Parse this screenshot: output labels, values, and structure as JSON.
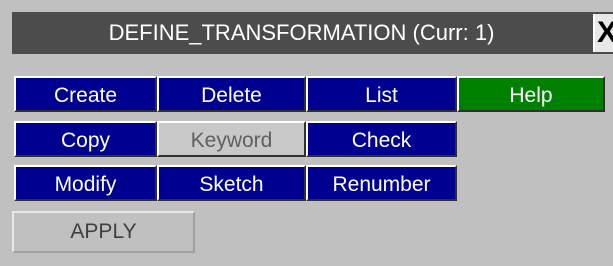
{
  "window": {
    "title": "DEFINE_TRANSFORMATION (Curr: 1)",
    "close_label": "X"
  },
  "buttons": {
    "create": "Create",
    "delete": "Delete",
    "list": "List",
    "help": "Help",
    "copy": "Copy",
    "keyword": "Keyword",
    "check": "Check",
    "modify": "Modify",
    "sketch": "Sketch",
    "renumber": "Renumber",
    "apply": "APPLY"
  },
  "colors": {
    "panel_background": "#c0c0c0",
    "title_background": "#4c4c4c",
    "button_blue": "#000090",
    "button_green": "#008000",
    "button_disabled": "#c8c8c8"
  }
}
